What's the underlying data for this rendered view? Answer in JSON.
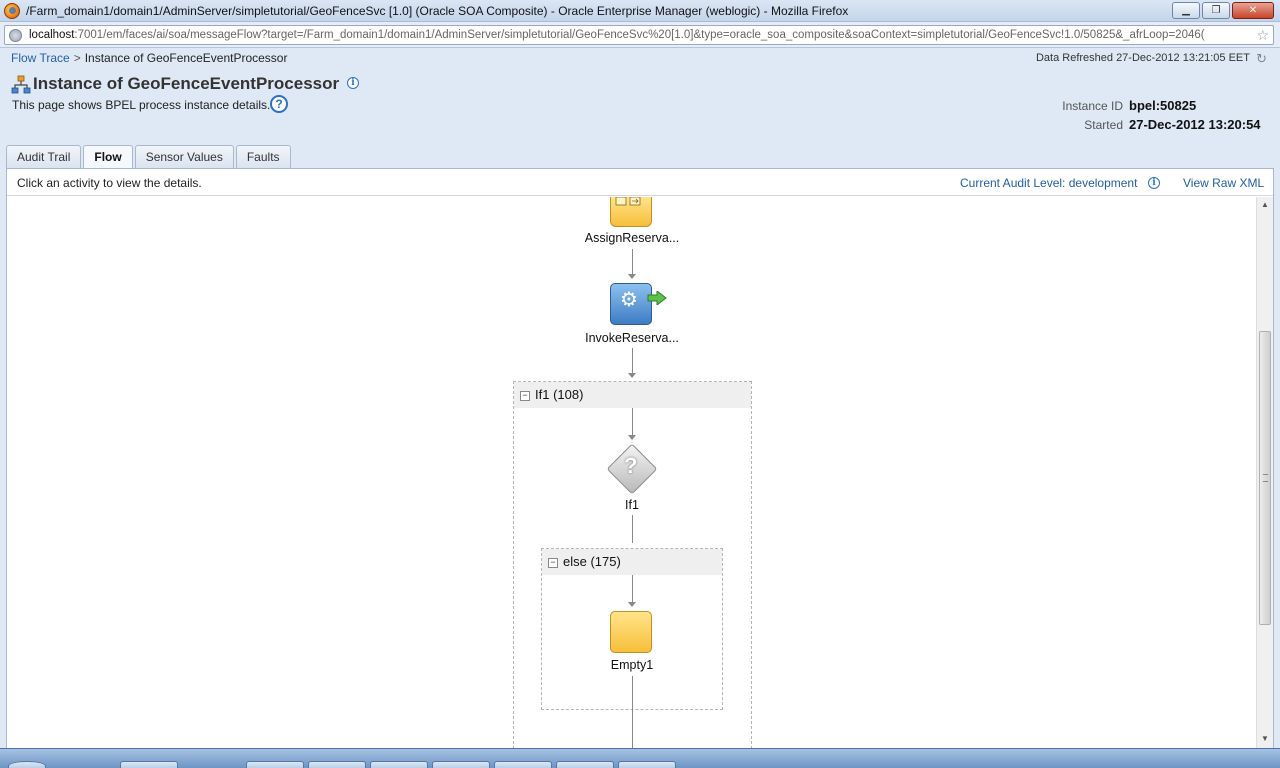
{
  "window": {
    "title": "/Farm_domain1/domain1/AdminServer/simpletutorial/GeoFenceSvc [1.0] (Oracle SOA Composite) - Oracle Enterprise Manager (weblogic) - Mozilla Firefox",
    "minimize": "▁",
    "maximize": "❐",
    "close": "✕"
  },
  "address": {
    "host": "localhost",
    "rest": ":7001/em/faces/ai/soa/messageFlow?target=/Farm_domain1/domain1/AdminServer/simpletutorial/GeoFenceSvc%20[1.0]&type=oracle_soa_composite&soaContext=simpletutorial/GeoFenceSvc!1.0/50825&_afrLoop=2046("
  },
  "breadcrumb": {
    "link": "Flow Trace",
    "separator": ">",
    "current": "Instance of GeoFenceEventProcessor"
  },
  "data_refreshed": "Data Refreshed 27-Dec-2012 13:21:05 EET",
  "page": {
    "title": "Instance of GeoFenceEventProcessor",
    "description": "This page shows BPEL process instance details."
  },
  "instance": {
    "id_label": "Instance ID",
    "id_value": "bpel:50825",
    "started_label": "Started",
    "started_value": "27-Dec-2012 13:20:54"
  },
  "tabs": [
    "Audit Trail",
    "Flow",
    "Sensor Values",
    "Faults"
  ],
  "active_tab": "Flow",
  "toolbar": {
    "hint": "Click an activity to view the details.",
    "audit_level": "Current Audit Level: development",
    "raw_xml": "View Raw XML"
  },
  "flow": {
    "assign_label": "AssignReserva...",
    "invoke_label": "InvokeReserva...",
    "if_scope": "If1 (108)",
    "if_label": "If1",
    "else_scope": "else (175)",
    "empty_label": "Empty1"
  },
  "icons": {
    "info": "i",
    "help": "?",
    "refresh": "↻",
    "star": "☆",
    "collapse": "−",
    "gear": "⚙",
    "question": "?"
  },
  "colors": {
    "link": "#245ea8",
    "page_bg": "#dfe9f5",
    "assign_fill": "#f7bf3a",
    "invoke_fill": "#3d7cc4",
    "invoke_arrow": "#5cc24a"
  }
}
